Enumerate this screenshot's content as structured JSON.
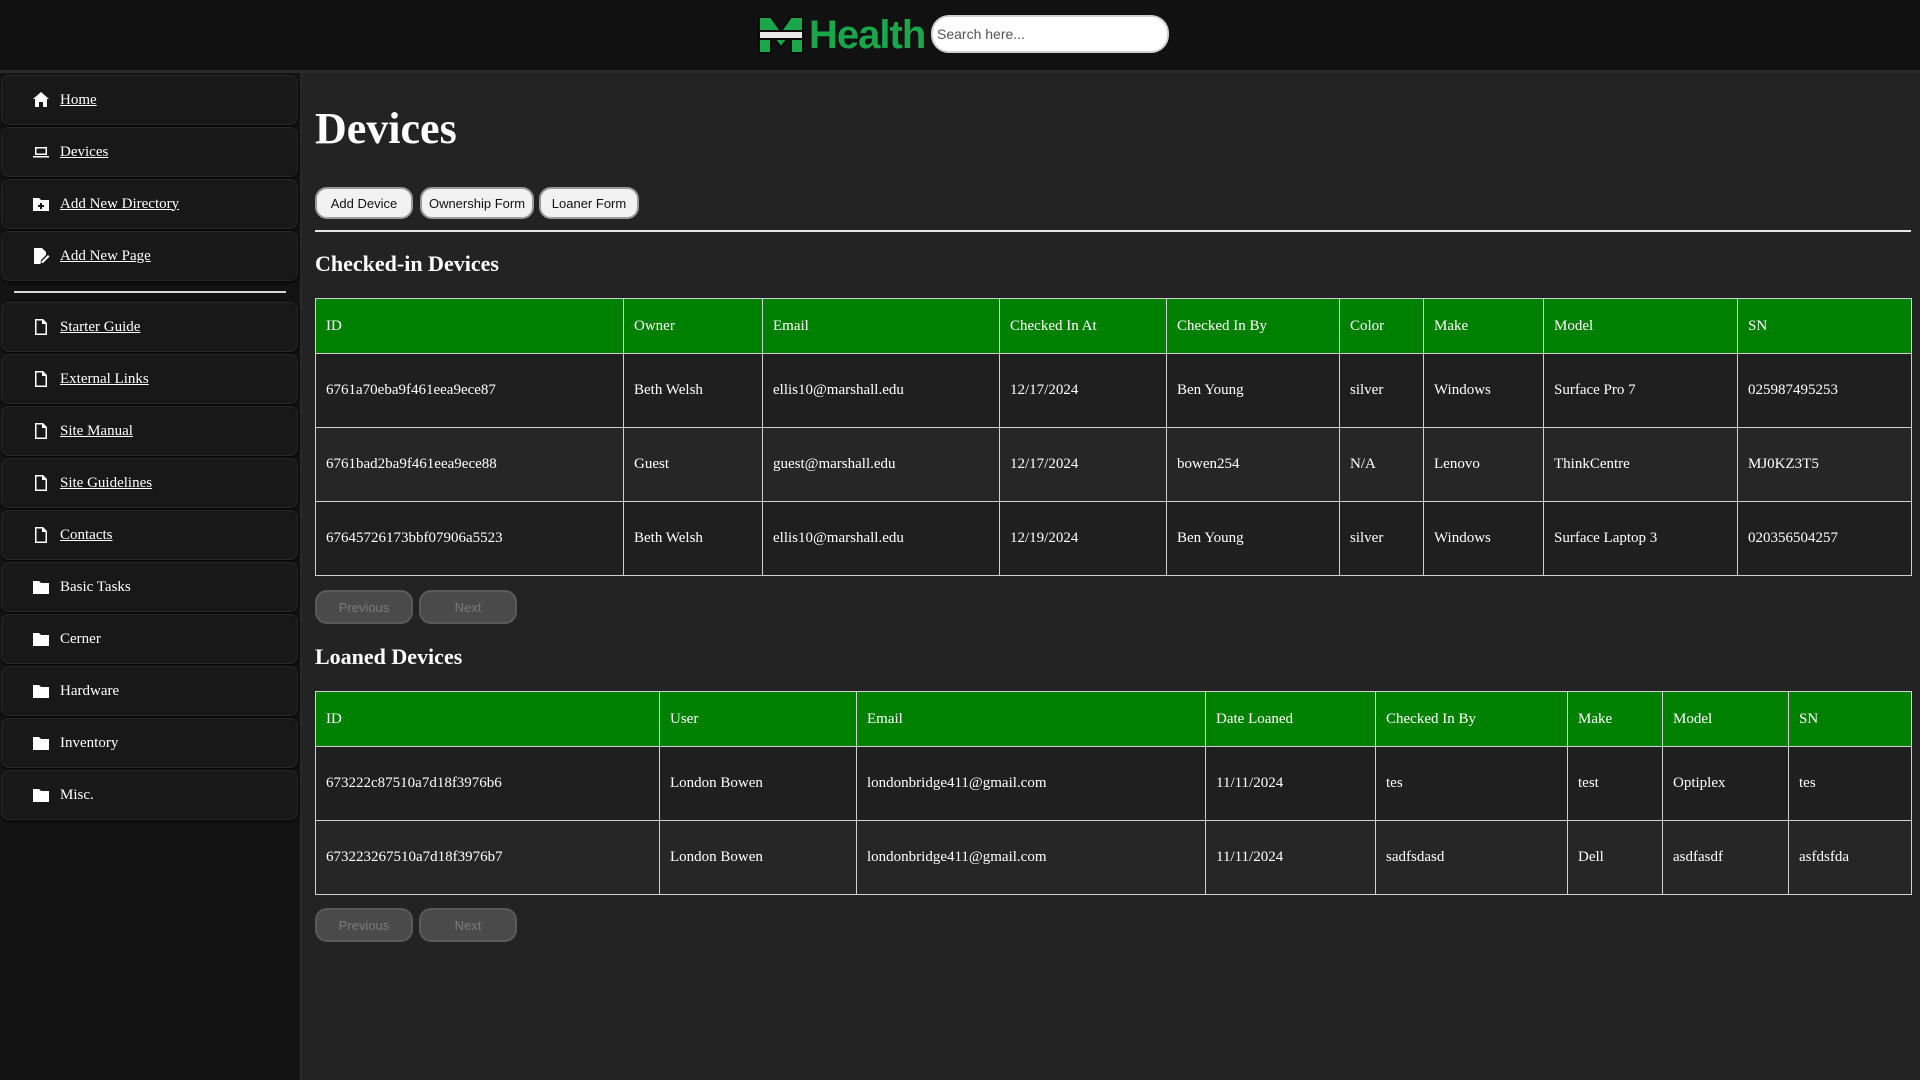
{
  "header": {
    "logo_text": "Health",
    "search_placeholder": "Search here..."
  },
  "sidebar": {
    "items": [
      {
        "label": "Home",
        "icon": "home-icon"
      },
      {
        "label": "Devices",
        "icon": "laptop-icon"
      },
      {
        "label": "Add New Directory",
        "icon": "folder-plus-icon"
      },
      {
        "label": "Add New Page",
        "icon": "file-edit-icon"
      },
      {
        "label": "Starter Guide",
        "icon": "file-icon"
      },
      {
        "label": "External Links",
        "icon": "file-icon"
      },
      {
        "label": "Site Manual",
        "icon": "file-icon"
      },
      {
        "label": "Site Guidelines",
        "icon": "file-icon"
      },
      {
        "label": "Contacts",
        "icon": "file-icon"
      },
      {
        "label": "Basic Tasks",
        "icon": "folder-icon"
      },
      {
        "label": "Cerner",
        "icon": "folder-icon"
      },
      {
        "label": "Hardware",
        "icon": "folder-icon"
      },
      {
        "label": "Inventory",
        "icon": "folder-icon"
      },
      {
        "label": "Misc.",
        "icon": "folder-icon"
      }
    ]
  },
  "main": {
    "title": "Devices",
    "actions": {
      "add_device": "Add Device",
      "ownership_form": "Ownership Form",
      "loaner_form": "Loaner Form"
    },
    "checked_in": {
      "title": "Checked-in Devices",
      "columns": [
        "ID",
        "Owner",
        "Email",
        "Checked In At",
        "Checked In By",
        "Color",
        "Make",
        "Model",
        "SN"
      ],
      "rows": [
        [
          "6761a70eba9f461eea9ece87",
          "Beth Welsh",
          "ellis10@marshall.edu",
          "12/17/2024",
          "Ben Young",
          "silver",
          "Windows",
          "Surface Pro 7",
          "025987495253"
        ],
        [
          "6761bad2ba9f461eea9ece88",
          "Guest",
          "guest@marshall.edu",
          "12/17/2024",
          "bowen254",
          "N/A",
          "Lenovo",
          "ThinkCentre",
          "MJ0KZ3T5"
        ],
        [
          "67645726173bbf07906a5523",
          "Beth Welsh",
          "ellis10@marshall.edu",
          "12/19/2024",
          "Ben Young",
          "silver",
          "Windows",
          "Surface Laptop 3",
          "020356504257"
        ]
      ],
      "prev": "Previous",
      "next": "Next"
    },
    "loaned": {
      "title": "Loaned Devices",
      "columns": [
        "ID",
        "User",
        "Email",
        "Date Loaned",
        "Checked In By",
        "Make",
        "Model",
        "SN"
      ],
      "rows": [
        [
          "673222c87510a7d18f3976b6",
          "London Bowen",
          "londonbridge411@gmail.com",
          "11/11/2024",
          "tes",
          "test",
          "Optiplex",
          "tes"
        ],
        [
          "673223267510a7d18f3976b7",
          "London Bowen",
          "londonbridge411@gmail.com",
          "11/11/2024",
          "sadfsdasd",
          "Dell",
          "asdfasdf",
          "asfdsfda"
        ]
      ],
      "prev": "Previous",
      "next": "Next"
    }
  },
  "colors": {
    "accent_green": "#008000",
    "logo_green": "#1aa64a",
    "background": "#232323"
  }
}
